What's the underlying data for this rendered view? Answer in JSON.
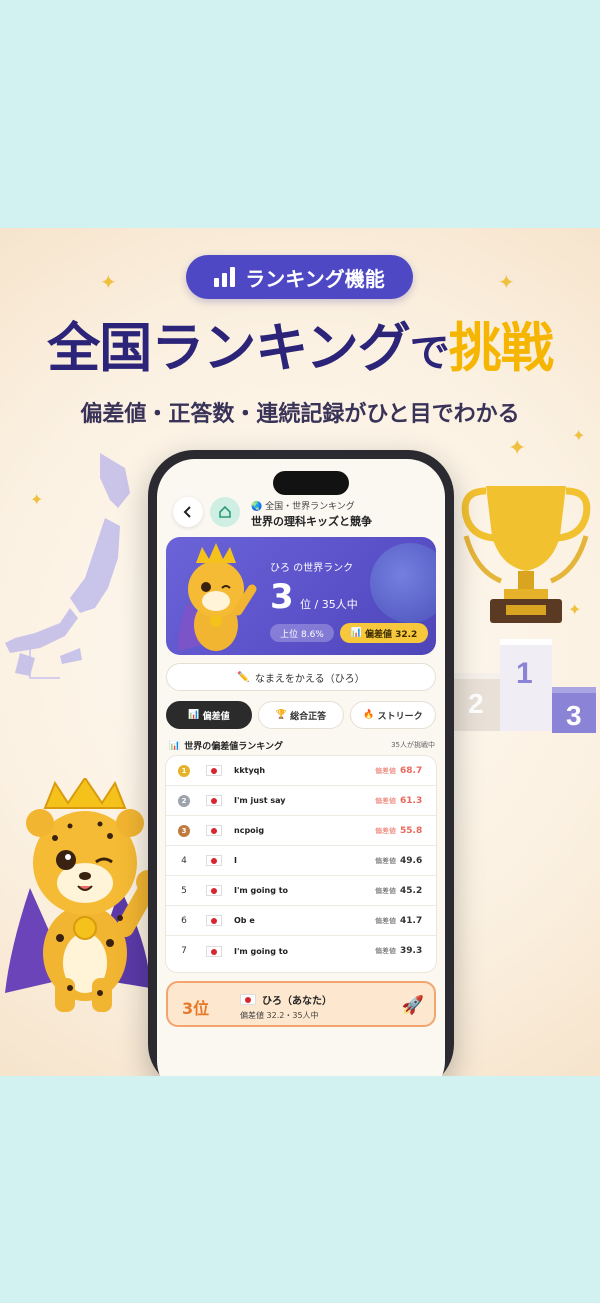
{
  "promo": {
    "badge_label": "ランキング機能",
    "headline_main": "全国ランキング",
    "headline_mid": "で",
    "headline_accent": "挑戦",
    "subhead": "偏差値・正答数・連続記録がひと目でわかる"
  },
  "app": {
    "title_sub": "🌏 全国・世界ランキング",
    "title_main": "世界の理科キッズと競争",
    "rank_card": {
      "name_line": "ひろ の世界ランク",
      "rank_number": "3",
      "rank_suffix": "位 / 35人中",
      "top_percent": "上位 8.6%",
      "deviation": "偏差値 32.2"
    },
    "rename_label": "なまえをかえる（ひろ）",
    "tabs": [
      {
        "label": "偏差値",
        "icon": "chart-icon"
      },
      {
        "label": "総合正答",
        "icon": "trophy-icon"
      },
      {
        "label": "ストリーク",
        "icon": "fire-icon"
      }
    ],
    "list_title": "世界の偏差値ランキング",
    "list_count": "35人が挑戦中",
    "score_label": "偏差値",
    "ranking": [
      {
        "rank": "1",
        "name": "kktyqh",
        "score": "68.7"
      },
      {
        "rank": "2",
        "name": "I'm just say",
        "score": "61.3"
      },
      {
        "rank": "3",
        "name": "ncpoig",
        "score": "55.8"
      },
      {
        "rank": "4",
        "name": "I",
        "score": "49.6"
      },
      {
        "rank": "5",
        "name": "I'm going to",
        "score": "45.2"
      },
      {
        "rank": "6",
        "name": "Ob e",
        "score": "41.7"
      },
      {
        "rank": "7",
        "name": "I'm going to",
        "score": "39.3"
      }
    ],
    "me": {
      "rank": "3位",
      "name": "ひろ（あなた）",
      "sub": "偏差値 32.2・35人中"
    }
  },
  "podium_labels": [
    "2",
    "1",
    "3"
  ],
  "colors": {
    "brand": "#4e48c4",
    "accent": "#f5b500",
    "highlight": "#e8685a"
  }
}
